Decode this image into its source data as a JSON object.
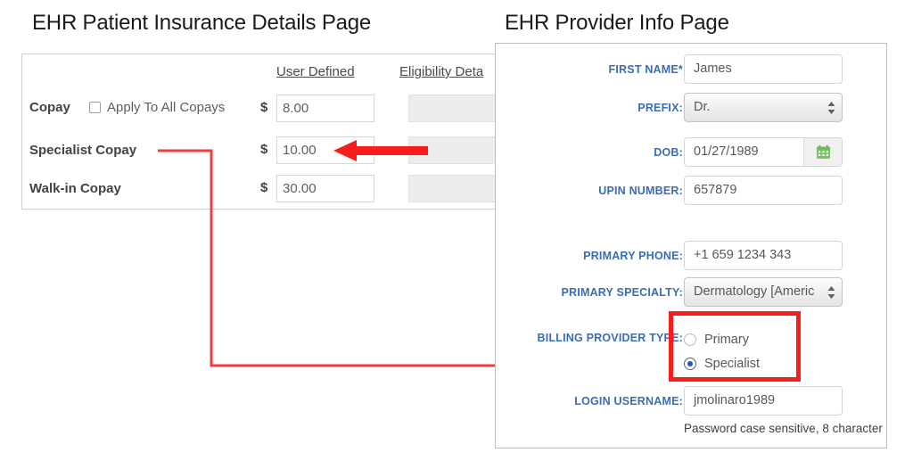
{
  "left_page": {
    "title": "EHR Patient Insurance Details Page",
    "columns": [
      {
        "label": "User Defined"
      },
      {
        "label": "Eligibility Deta"
      }
    ],
    "rows": [
      {
        "label": "Copay",
        "checkbox_label": "Apply To All Copays",
        "currency": "$",
        "user_defined_value": "8.00",
        "eligibility_value": ""
      },
      {
        "label": "Specialist Copay",
        "currency": "$",
        "user_defined_value": "10.00",
        "eligibility_value": ""
      },
      {
        "label": "Walk-in Copay",
        "currency": "$",
        "user_defined_value": "30.00",
        "eligibility_value": ""
      }
    ]
  },
  "right_page": {
    "title": "EHR Provider Info Page",
    "fields": [
      {
        "label": "FIRST NAME*",
        "type": "text",
        "value": "James"
      },
      {
        "label": "PREFIX:",
        "type": "select",
        "value": "Dr."
      },
      {
        "label": "DOB:",
        "type": "date",
        "value": "01/27/1989",
        "button_icon": "calendar-icon"
      },
      {
        "label": "UPIN NUMBER:",
        "type": "text",
        "value": "657879"
      },
      {
        "label": "PRIMARY PHONE:",
        "type": "text",
        "value": "+1 659 1234 343"
      },
      {
        "label": "PRIMARY SPECIALTY:",
        "type": "select",
        "value": "Dermatology  [Americ"
      },
      {
        "label": "BILLING PROVIDER TYPE:",
        "type": "radio",
        "options": [
          "Primary",
          "Specialist"
        ],
        "selected": "Specialist"
      },
      {
        "label": "LOGIN USERNAME:",
        "type": "text",
        "value": "jmolinaro1989"
      }
    ],
    "helper_text": "Password case sensitive, 8 character"
  },
  "annotations": {
    "arrow_color": "#f71d1d",
    "highlight_color": "#f71d1d",
    "connector_color": "#f53b3b"
  }
}
